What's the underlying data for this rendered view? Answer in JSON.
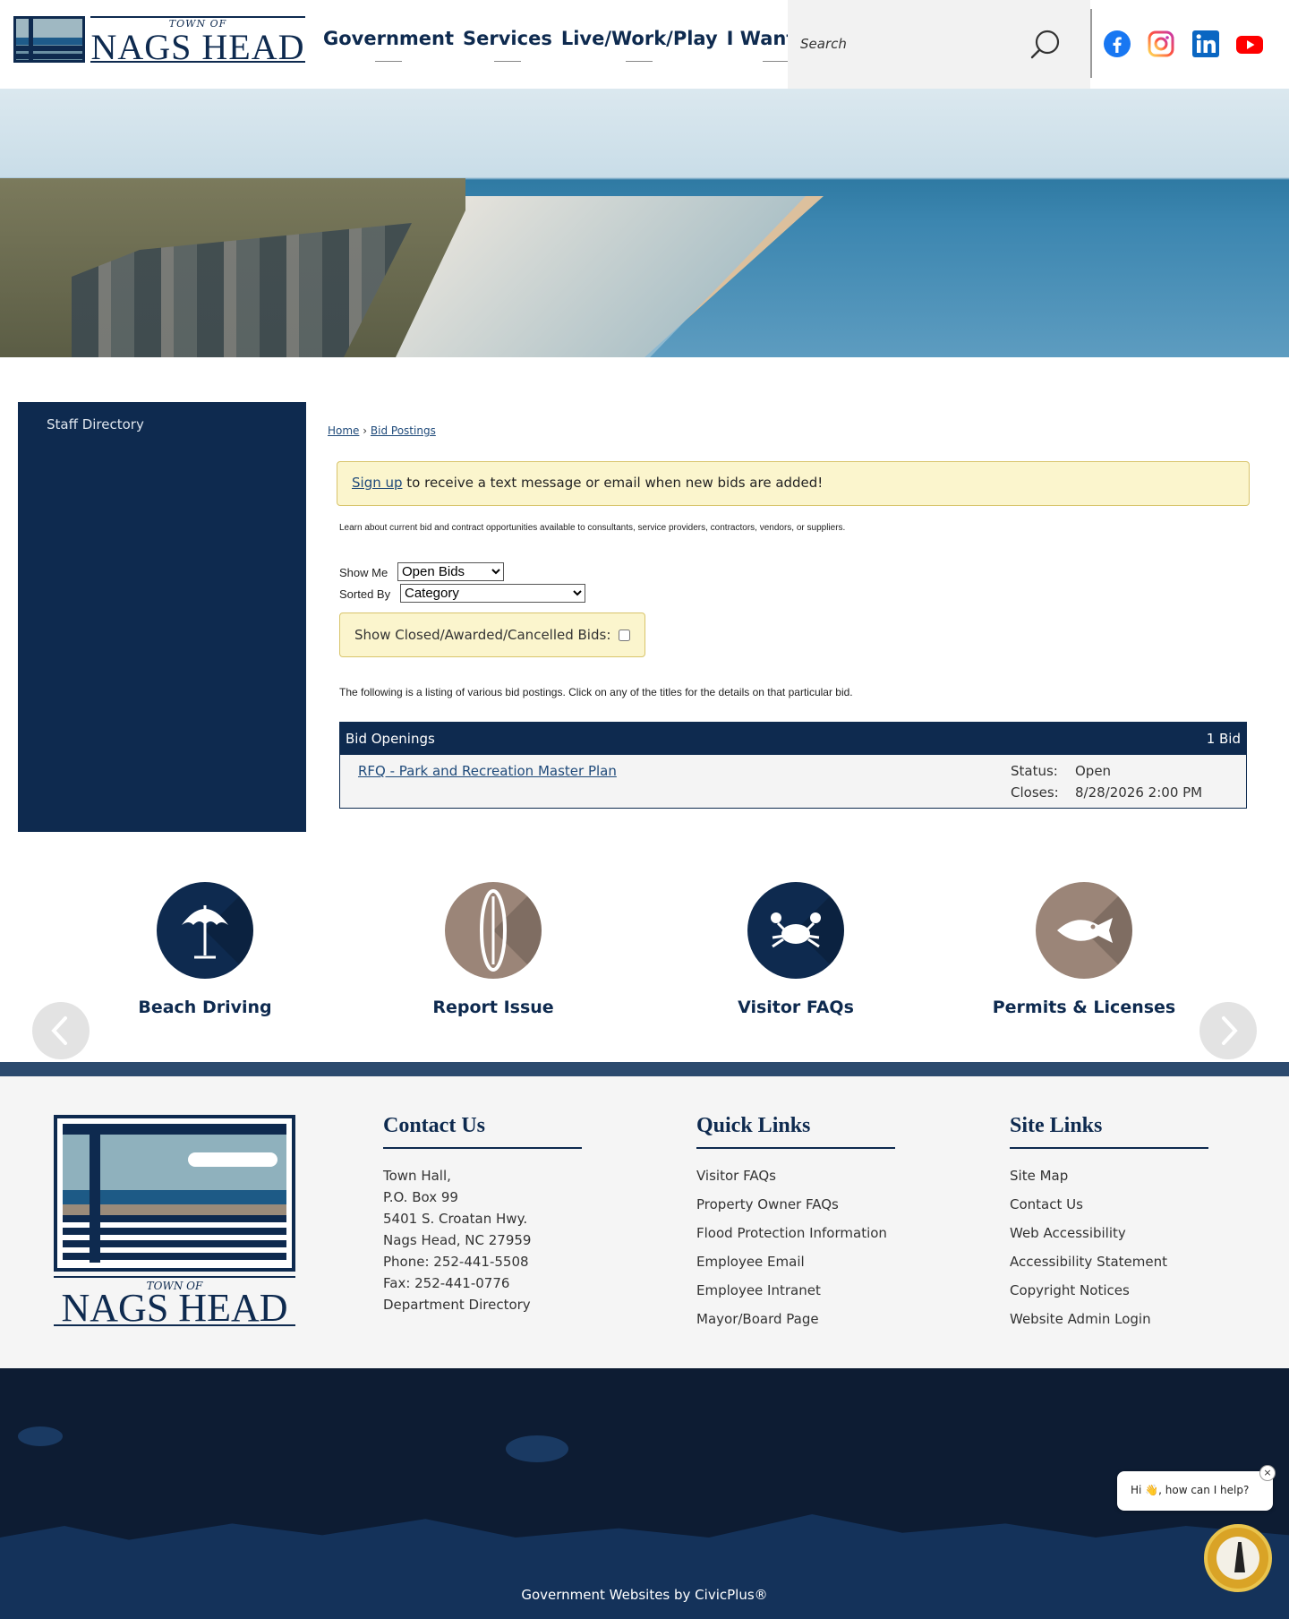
{
  "header": {
    "logo_small": "TOWN OF",
    "logo_big": "NAGS HEAD",
    "nav": [
      "Government",
      "Services",
      "Live/Work/Play",
      "I Want To"
    ],
    "search_placeholder": "Search"
  },
  "social": [
    "facebook-icon",
    "instagram-icon",
    "linkedin-icon",
    "youtube-icon"
  ],
  "sidebar": {
    "items": [
      "Staff Directory"
    ]
  },
  "breadcrumb": {
    "home": "Home",
    "sep": "›",
    "current": "Bid Postings"
  },
  "notice": {
    "link": "Sign up",
    "text": " to receive a text message or email when new bids are added!"
  },
  "intro": "Learn about current bid and contract opportunities available to consultants, service providers, contractors, vendors, or suppliers.",
  "filters": {
    "show_me_label": "Show Me",
    "show_me_value": "Open Bids",
    "sorted_by_label": "Sorted By",
    "sorted_by_value": "Category",
    "closed_label": "Show Closed/Awarded/Cancelled Bids:"
  },
  "listing_text": "The following is a listing of various bid postings. Click on any of the titles for the details on that particular bid.",
  "bids": {
    "header": "Bid Openings",
    "count": "1 Bid",
    "rows": [
      {
        "title": "RFQ - Park and Recreation Master Plan",
        "status_label": "Status:",
        "status": "Open",
        "closes_label": "Closes:",
        "closes": "8/28/2026 2:00 PM"
      }
    ]
  },
  "quick_links": [
    {
      "label": "Beach Driving",
      "icon": "umbrella-icon",
      "color": "#0e2a4f"
    },
    {
      "label": "Report Issue",
      "icon": "surfboard-icon",
      "color": "#9b8578"
    },
    {
      "label": "Visitor FAQs",
      "icon": "crab-icon",
      "color": "#0e2a4f"
    },
    {
      "label": "Permits & Licenses",
      "icon": "fish-icon",
      "color": "#9b8578"
    }
  ],
  "footer": {
    "logo_small": "TOWN OF",
    "logo_big": "NAGS HEAD",
    "contact": {
      "title": "Contact Us",
      "lines": [
        "Town Hall,",
        "P.O. Box 99",
        "5401 S. Croatan Hwy.",
        "Nags Head, NC 27959",
        "Phone: 252-441-5508",
        "Fax: 252-441-0776",
        "Department Directory"
      ]
    },
    "quick": {
      "title": "Quick Links",
      "links": [
        "Visitor FAQs",
        "Property Owner FAQs",
        "Flood Protection Information",
        "Employee Email",
        "Employee Intranet",
        "Mayor/Board Page"
      ]
    },
    "site": {
      "title": "Site Links",
      "links": [
        "Site Map",
        "Contact Us",
        "Web Accessibility",
        "Accessibility Statement",
        "Copyright Notices",
        "Website Admin Login"
      ]
    },
    "credit": "Government Websites by CivicPlus®"
  },
  "chat": {
    "text": "Hi 👋, how can I help?",
    "close": "×"
  },
  "colors": {
    "navy": "#0e2a4f",
    "notice_bg": "#fbf5cd",
    "taupe": "#9b8578"
  }
}
